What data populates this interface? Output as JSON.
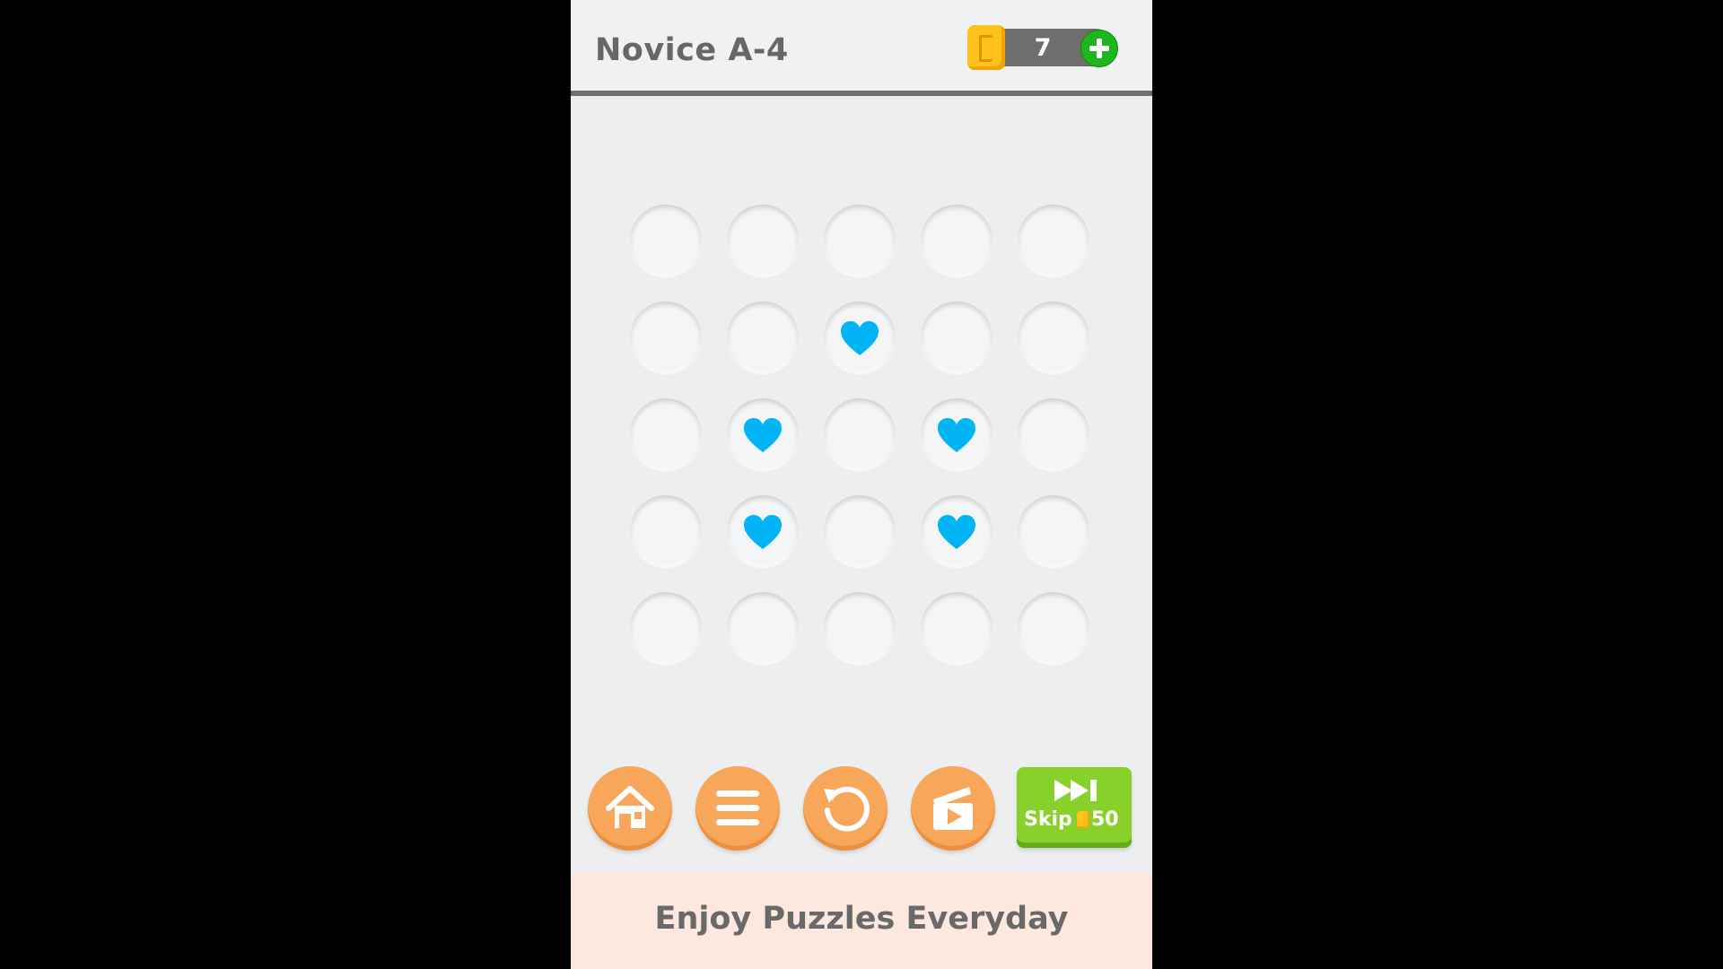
{
  "header": {
    "level_title": "Novice A-4",
    "coins": "7"
  },
  "board": {
    "rows": 5,
    "cols": 5,
    "cells": [
      [
        "empty",
        "empty",
        "empty",
        "empty",
        "empty"
      ],
      [
        "empty",
        "empty",
        "heart",
        "empty",
        "empty"
      ],
      [
        "empty",
        "heart",
        "empty",
        "heart",
        "empty"
      ],
      [
        "empty",
        "heart",
        "empty",
        "heart",
        "empty"
      ],
      [
        "empty",
        "empty",
        "empty",
        "empty",
        "empty"
      ]
    ],
    "heart_color": "#00b4f5"
  },
  "toolbar": {
    "home_icon": "home-icon",
    "menu_icon": "menu-icon",
    "restart_icon": "restart-icon",
    "video_icon": "video-play-icon",
    "skip_label": "Skip",
    "skip_cost": "50"
  },
  "footer": {
    "tagline": "Enjoy Puzzles Everyday"
  },
  "colors": {
    "accent_orange": "#f8a65a",
    "skip_green": "#88d12a",
    "coin_gold": "#ffc21a",
    "add_green": "#1fb51f"
  }
}
